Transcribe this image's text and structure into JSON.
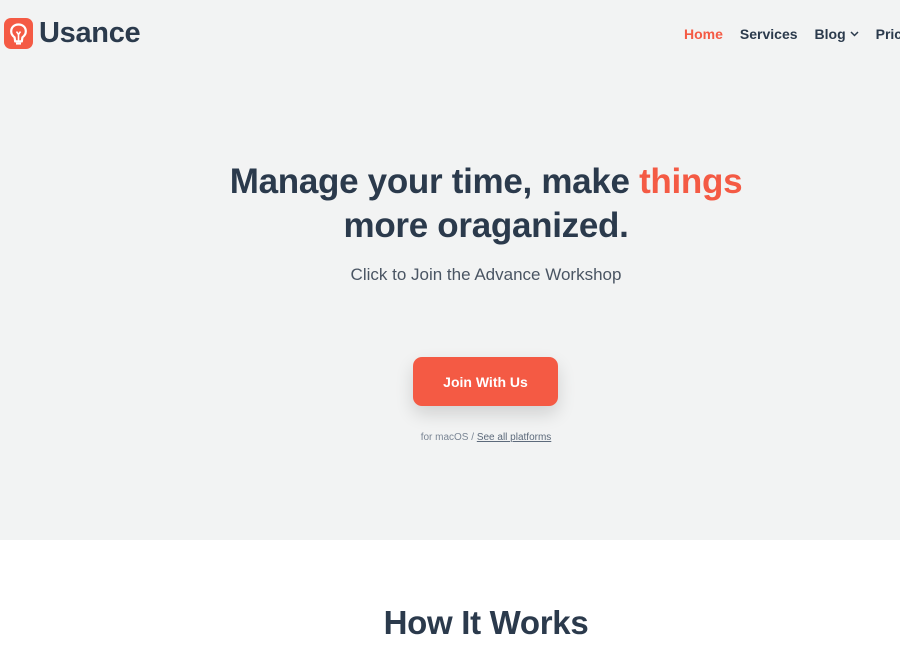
{
  "brand": {
    "name": "Usance",
    "icon": "lightbulb-icon",
    "accent_color": "#f45a44",
    "text_color": "#2b3a4c"
  },
  "nav": {
    "items": [
      {
        "label": "Home",
        "active": true
      },
      {
        "label": "Services"
      },
      {
        "label": "Blog",
        "icon": "chevron-down-icon"
      },
      {
        "label": "Pricing"
      }
    ]
  },
  "hero": {
    "headline_part1": "Manage your time, make ",
    "headline_accent": "things",
    "headline_part2": "more oraganized.",
    "subhead": "Click to Join the Advance Workshop",
    "cta_label": "Join With Us",
    "platform_prefix": "for macOS / ",
    "platform_link": "See all platforms"
  },
  "section": {
    "title": "How It Works"
  }
}
